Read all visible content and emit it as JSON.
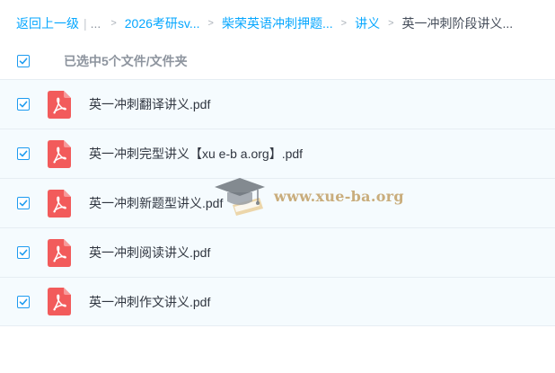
{
  "breadcrumb": {
    "back_label": "返回上一级",
    "ellipsis": "...",
    "crumbs": [
      "2026考研sv...",
      "柴荣英语冲刺押题...",
      "讲义"
    ],
    "current": "英一冲刺阶段讲义...",
    "separator": ">"
  },
  "selection": {
    "text": "已选中5个文件/文件夹",
    "all_checked": true
  },
  "files": [
    {
      "name": "英一冲刺翻译讲义.pdf",
      "type": "pdf",
      "checked": true
    },
    {
      "name": "英一冲刺完型讲义【xu e-b a.org】.pdf",
      "type": "pdf",
      "checked": true
    },
    {
      "name": "英一冲刺新题型讲义.pdf",
      "type": "pdf",
      "checked": true
    },
    {
      "name": "英一冲刺阅读讲义.pdf",
      "type": "pdf",
      "checked": true
    },
    {
      "name": "英一冲刺作文讲义.pdf",
      "type": "pdf",
      "checked": true
    }
  ],
  "watermark": {
    "text": "www.xue-ba.org",
    "icon": "graduation-cap-icon"
  },
  "colors": {
    "link": "#06a7ff",
    "checkbox": "#1d9bf0",
    "pdf_icon": "#f25b5b",
    "row_bg": "#f5fbfe",
    "watermark": "#c9ad7c"
  }
}
